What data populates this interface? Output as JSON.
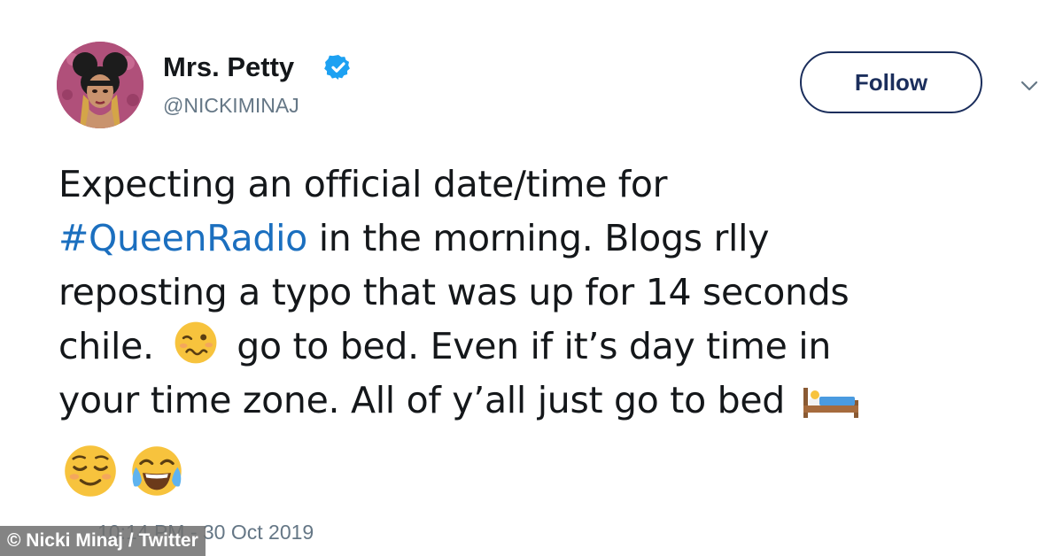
{
  "author": {
    "display_name": "Mrs. Petty",
    "handle": "@NICKIMINAJ",
    "verified": true,
    "avatar_icon": "profile-avatar"
  },
  "actions": {
    "follow_label": "Follow",
    "menu_icon": "chevron-down-icon"
  },
  "tweet": {
    "line1": "Expecting an official date/time for",
    "hashtag": "#QueenRadio",
    "line2_rest": " in the morning. Blogs rlly",
    "line3": "reposting a typo that was up for 14 seconds",
    "line4_a": "chile.",
    "line4_b": "go to bed. Even if it’s day time in",
    "line5": "your time zone. All of y’all just go to bed",
    "emojis": [
      "woozy-face",
      "bed",
      "relieved-face",
      "tears-of-joy-face"
    ]
  },
  "timestamp": "10:14 PM - 30 Oct 2019",
  "credit": "© Nicki Minaj / Twitter",
  "colors": {
    "hashtag": "#1b6fbf",
    "follow_border": "#1b2e5c",
    "verified": "#1da1f2",
    "muted": "#657786"
  }
}
